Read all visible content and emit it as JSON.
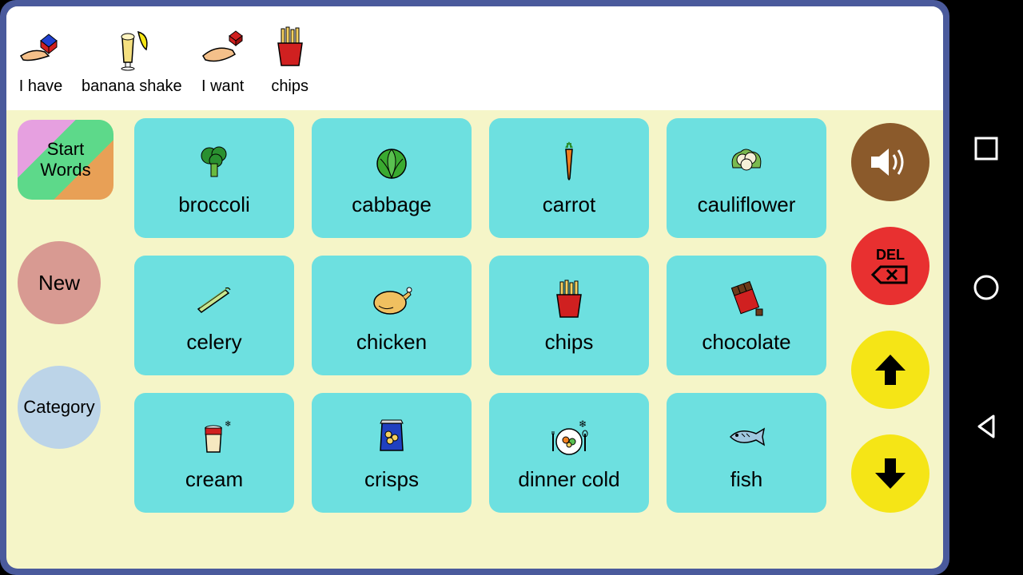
{
  "sentence": [
    {
      "label": "I have",
      "icon": "hand-cube"
    },
    {
      "label": "banana shake",
      "icon": "banana-shake"
    },
    {
      "label": "I want",
      "icon": "hand-want"
    },
    {
      "label": "chips",
      "icon": "chips"
    }
  ],
  "left": {
    "start_words_l1": "Start",
    "start_words_l2": "Words",
    "new": "New",
    "category": "Category"
  },
  "grid": [
    {
      "label": "broccoli",
      "icon": "broccoli"
    },
    {
      "label": "cabbage",
      "icon": "cabbage"
    },
    {
      "label": "carrot",
      "icon": "carrot"
    },
    {
      "label": "cauliflower",
      "icon": "cauliflower"
    },
    {
      "label": "celery",
      "icon": "celery"
    },
    {
      "label": "chicken",
      "icon": "chicken"
    },
    {
      "label": "chips",
      "icon": "chips"
    },
    {
      "label": "chocolate",
      "icon": "chocolate"
    },
    {
      "label": "cream",
      "icon": "cream"
    },
    {
      "label": "crisps",
      "icon": "crisps"
    },
    {
      "label": "dinner cold",
      "icon": "dinner-cold"
    },
    {
      "label": "fish",
      "icon": "fish"
    }
  ],
  "right": {
    "del_text": "DEL"
  }
}
